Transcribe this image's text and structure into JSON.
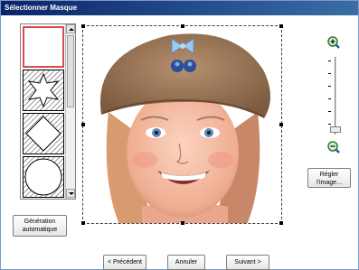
{
  "window": {
    "title": "Sélectionner Masque"
  },
  "mask_list": {
    "items": [
      {
        "shape": "rectangle",
        "selected": true
      },
      {
        "shape": "star",
        "selected": false
      },
      {
        "shape": "diamond",
        "selected": false
      },
      {
        "shape": "circle",
        "selected": false
      }
    ]
  },
  "preview": {
    "image_description": "photo"
  },
  "zoom": {
    "in_icon": "zoom-in-icon",
    "out_icon": "zoom-out-icon",
    "level": 0.05
  },
  "buttons": {
    "adjust_line1": "Régler",
    "adjust_line2": "l'image...",
    "generate_line1": "Génération",
    "generate_line2": "automatique",
    "previous": "< Précédent",
    "cancel": "Annuler",
    "next": "Suivant >"
  },
  "colors": {
    "title_bar": "#0a246a",
    "selection": "#d94b4b"
  }
}
